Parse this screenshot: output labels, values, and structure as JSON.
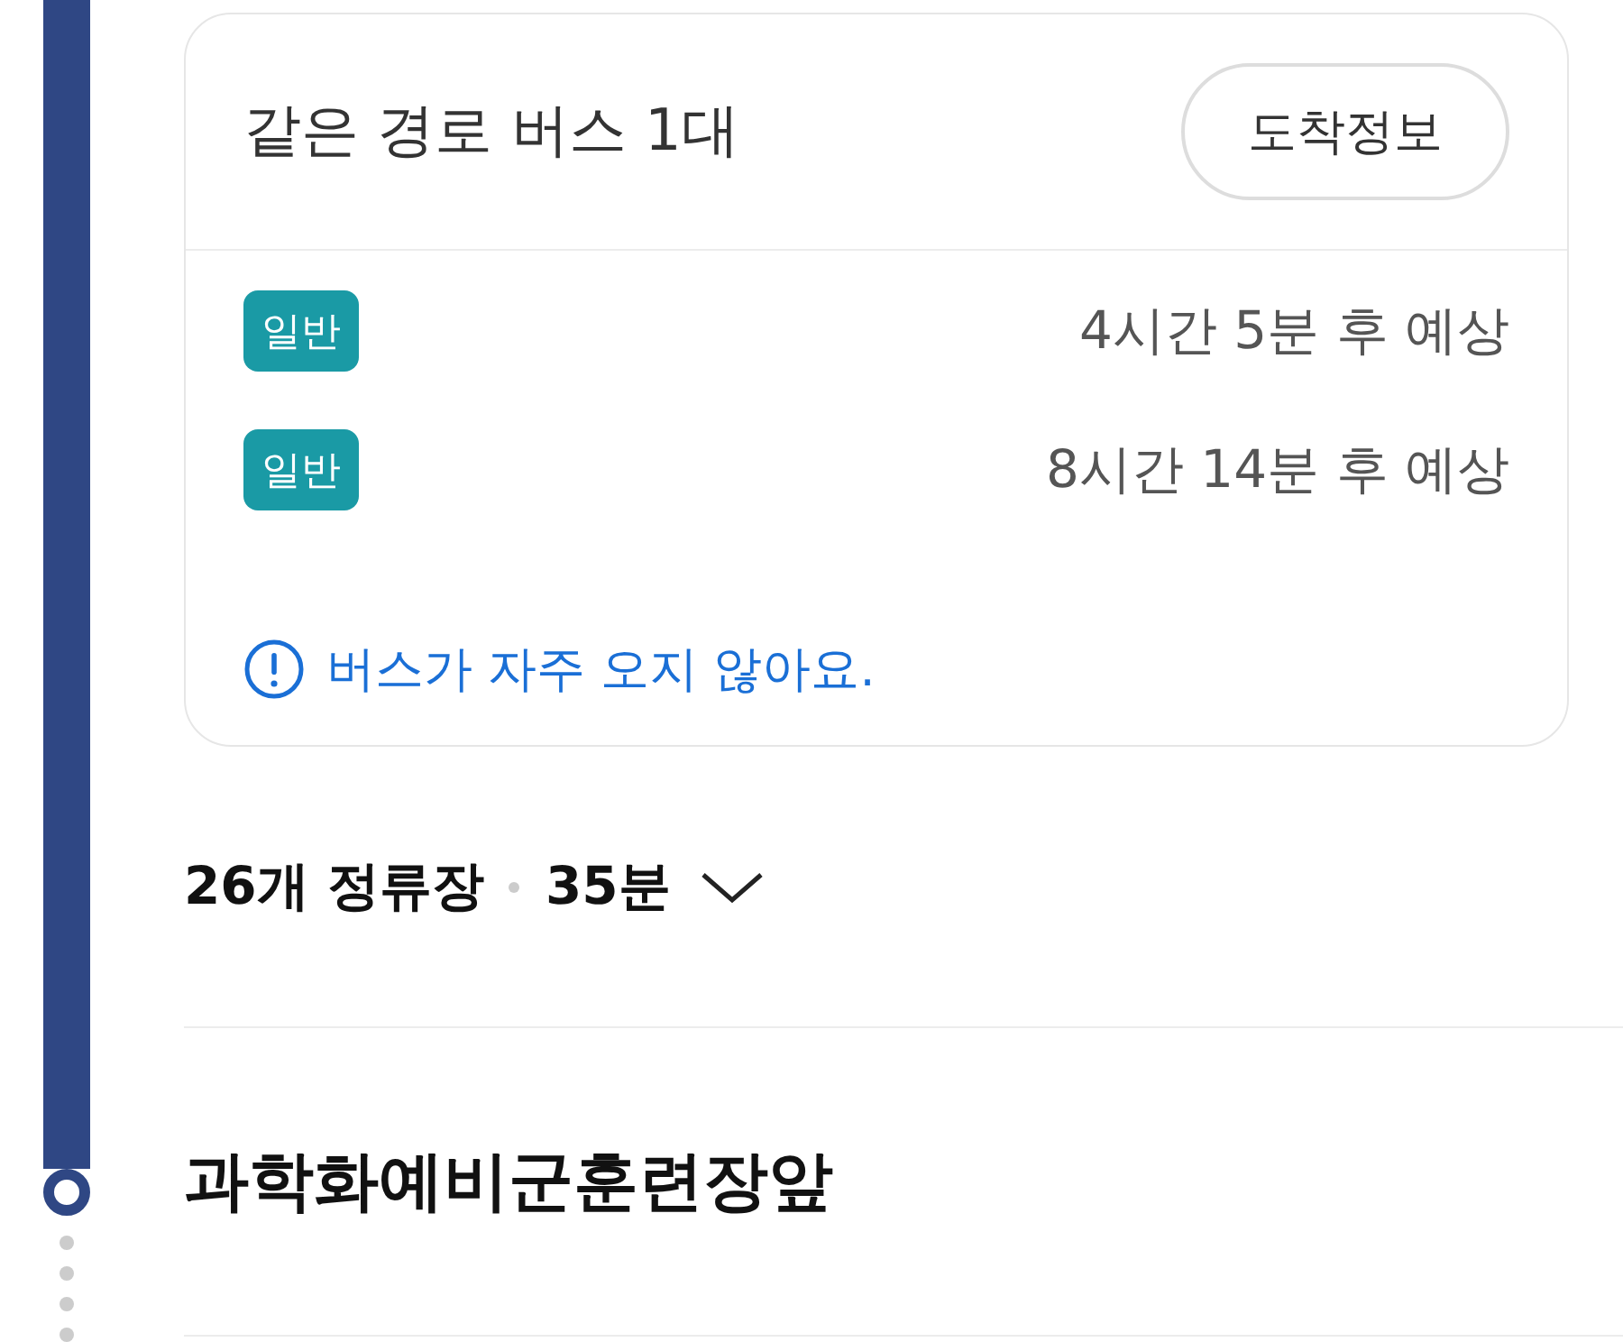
{
  "route_card": {
    "title": "같은 경로 버스 1대",
    "button": "도착정보",
    "arrivals": [
      {
        "badge": "일반",
        "eta": "4시간 5분 후 예상"
      },
      {
        "badge": "일반",
        "eta": "8시간 14분 후 예상"
      }
    ],
    "notice": "버스가 자주 오지 않아요."
  },
  "segment": {
    "stops": "26개 정류장",
    "duration": "35분",
    "expanded": false
  },
  "stop": {
    "name": "과학화예비군훈련장앞"
  }
}
